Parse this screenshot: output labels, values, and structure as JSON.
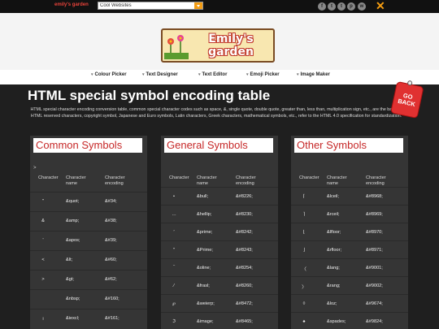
{
  "topbar": {
    "brand": "emily's garden",
    "search_value": "Cool Websites",
    "social_icons": [
      "facebook-icon",
      "twitter-icon",
      "tumblr-icon",
      "pinterest-icon",
      "wechat-icon"
    ],
    "social_glyphs": [
      "f",
      "t",
      "t",
      "p",
      "w"
    ],
    "close_glyph": "✕"
  },
  "header": {
    "logo_text": "Emily's garden"
  },
  "nav": {
    "items": [
      {
        "label": "Colour Picker"
      },
      {
        "label": "Text Designer"
      },
      {
        "label": "Text Editor"
      },
      {
        "label": "Emoji Picker"
      },
      {
        "label": "Image Maker"
      }
    ]
  },
  "main": {
    "title": "HTML special symbol encoding table",
    "intro": "HTML special character encoding conversion table, common special character codes such as space, &, single quote, double quote, greater than, less than, multiplication sign, etc., are the basis of HTML reserved characters, copyright symbol, Japanese and Euro symbols, Latin characters, Greek characters, mathematical symbols, etc., refer to the HTML 4.0 specification for standardization.",
    "go_back": "GO BACK"
  },
  "panels": [
    {
      "title": "Common Symbols",
      "gt": ">",
      "headers": {
        "character": "Character",
        "name": "Character name",
        "encoding": "Character encoding"
      },
      "rows": [
        {
          "char": "\"",
          "name": "&quot;",
          "code": "&#34;"
        },
        {
          "char": "&",
          "name": "&amp;",
          "code": "&#38;"
        },
        {
          "char": "'",
          "name": "&apos;",
          "code": "&#39;"
        },
        {
          "char": "<",
          "name": "&lt;",
          "code": "&#60;"
        },
        {
          "char": ">",
          "name": "&gt;",
          "code": "&#62;"
        },
        {
          "char": " ",
          "name": "&nbsp;",
          "code": "&#160;"
        },
        {
          "char": "¡",
          "name": "&iexcl;",
          "code": "&#161;"
        }
      ]
    },
    {
      "title": "General Symbols",
      "gt": "",
      "headers": {
        "character": "Character",
        "name": "Character name",
        "encoding": "Character encoding"
      },
      "rows": [
        {
          "char": "•",
          "name": "&bull;",
          "code": "&#8226;"
        },
        {
          "char": "…",
          "name": "&hellip;",
          "code": "&#8230;"
        },
        {
          "char": "′",
          "name": "&prime;",
          "code": "&#8242;"
        },
        {
          "char": "″",
          "name": "&Prime;",
          "code": "&#8243;"
        },
        {
          "char": "‾",
          "name": "&oline;",
          "code": "&#8254;"
        },
        {
          "char": "⁄",
          "name": "&frasl;",
          "code": "&#8260;"
        },
        {
          "char": "℘",
          "name": "&weierp;",
          "code": "&#8472;"
        },
        {
          "char": "ℑ",
          "name": "&image;",
          "code": "&#8465;"
        }
      ]
    },
    {
      "title": "Other Symbols",
      "gt": "",
      "headers": {
        "character": "Character",
        "name": "Character name",
        "encoding": "Character encoding"
      },
      "rows": [
        {
          "char": "⌈",
          "name": "&lceil;",
          "code": "&#8968;"
        },
        {
          "char": "⌉",
          "name": "&rceil;",
          "code": "&#8969;"
        },
        {
          "char": "⌊",
          "name": "&lfloor;",
          "code": "&#8970;"
        },
        {
          "char": "⌋",
          "name": "&rfloor;",
          "code": "&#8971;"
        },
        {
          "char": "〈",
          "name": "&lang;",
          "code": "&#9001;"
        },
        {
          "char": "〉",
          "name": "&rang;",
          "code": "&#9002;"
        },
        {
          "char": "◊",
          "name": "&loz;",
          "code": "&#9674;"
        },
        {
          "char": "♠",
          "name": "&spades;",
          "code": "&#9824;"
        }
      ]
    }
  ]
}
